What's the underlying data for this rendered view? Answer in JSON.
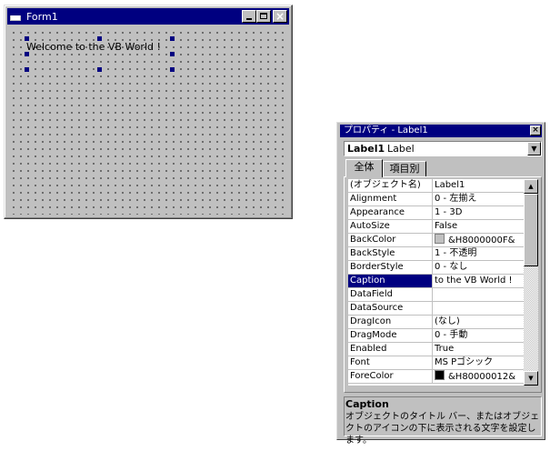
{
  "form": {
    "title": "Form1",
    "label_caption": "Welcome to the VB World !"
  },
  "properties": {
    "title": "プロパティ - Label1",
    "close_glyph": "×",
    "object_name": "Label1",
    "object_type": "Label",
    "tabs": [
      "全体",
      "項目別"
    ],
    "rows": [
      {
        "name": "(オブジェクト名)",
        "value": "Label1"
      },
      {
        "name": "Alignment",
        "value": "0 - 左揃え"
      },
      {
        "name": "Appearance",
        "value": "1 - 3D"
      },
      {
        "name": "AutoSize",
        "value": "False"
      },
      {
        "name": "BackColor",
        "value": "&H8000000F&",
        "swatch": "#c0c0c0"
      },
      {
        "name": "BackStyle",
        "value": "1 - 不透明"
      },
      {
        "name": "BorderStyle",
        "value": "0 - なし"
      },
      {
        "name": "Caption",
        "value": "to the VB World !"
      },
      {
        "name": "DataField",
        "value": ""
      },
      {
        "name": "DataSource",
        "value": ""
      },
      {
        "name": "DragIcon",
        "value": "(なし)"
      },
      {
        "name": "DragMode",
        "value": "0 - 手動"
      },
      {
        "name": "Enabled",
        "value": "True"
      },
      {
        "name": "Font",
        "value": "MS Pゴシック"
      },
      {
        "name": "ForeColor",
        "value": "&H80000012&",
        "swatch": "#000000"
      }
    ],
    "selected_row": "Caption",
    "description": {
      "title": "Caption",
      "text": "オブジェクトのタイトル バー、またはオブジェクトのアイコンの下に表示される文字を設定します。"
    }
  },
  "colors": {
    "titlebar": "#000080",
    "face": "#c0c0c0",
    "selection": "#000080"
  }
}
